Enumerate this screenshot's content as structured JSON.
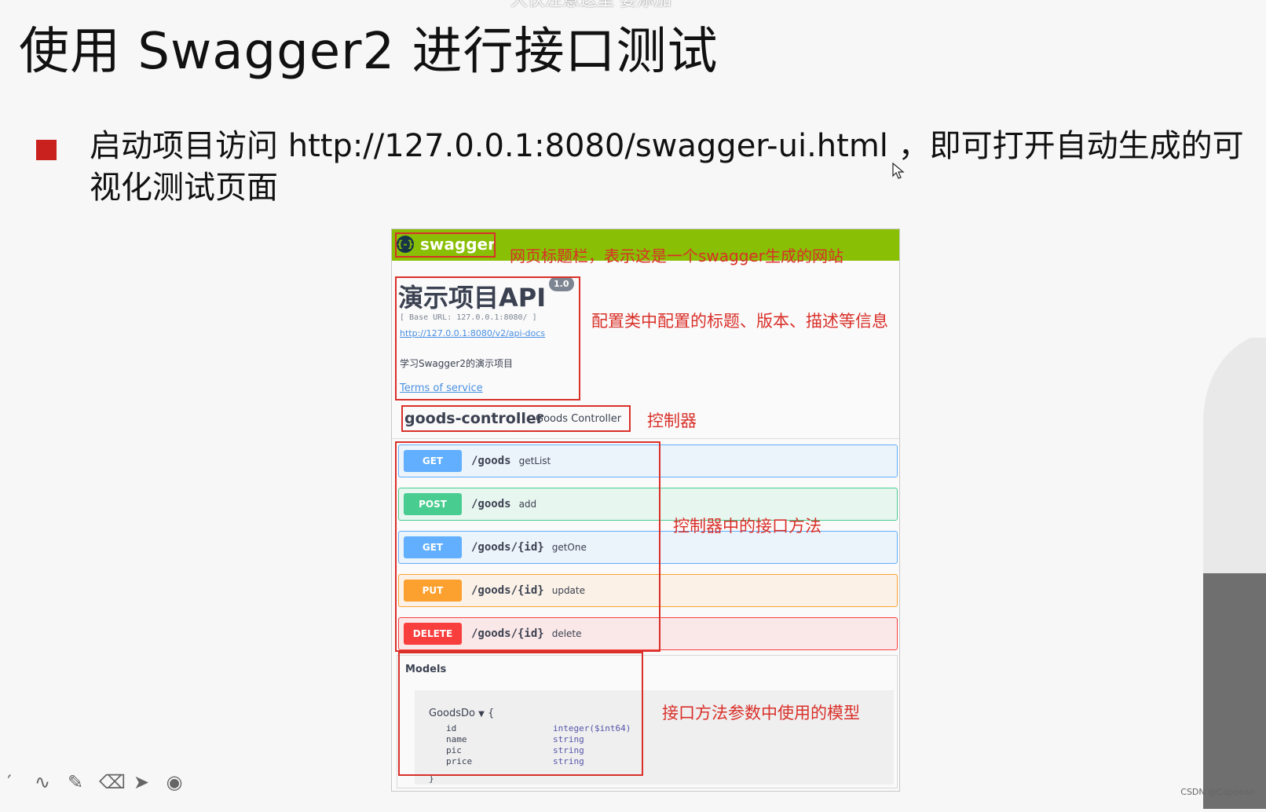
{
  "slide": {
    "title": "使用 Swagger2 进行接口测试",
    "top_subtitle": "大伙注意这里 要添加",
    "bullet_text": "启动项目访问 http://127.0.0.1:8080/swagger-ui.html ，即可打开自动生成的可视化测试页面"
  },
  "swagger": {
    "brand": "swagger",
    "logo_icon": "{-}",
    "api_title": "演示项目API",
    "version": "1.0",
    "base_url": "[ Base URL: 127.0.0.1:8080/ ]",
    "docs_link": "http://127.0.0.1:8080/v2/api-docs",
    "description": "学习Swagger2的演示项目",
    "terms_link": "Terms of service",
    "controller_name": "goods-controller",
    "controller_desc": "Goods Controller",
    "operations": [
      {
        "method": "GET",
        "path": "/goods",
        "summary": "getList",
        "color": "#61affe",
        "bg": "#ebf3fb",
        "border": "#61affe"
      },
      {
        "method": "POST",
        "path": "/goods",
        "summary": "add",
        "color": "#49cc90",
        "bg": "#e8f6f0",
        "border": "#49cc90"
      },
      {
        "method": "GET",
        "path": "/goods/{id}",
        "summary": "getOne",
        "color": "#61affe",
        "bg": "#ebf3fb",
        "border": "#61affe"
      },
      {
        "method": "PUT",
        "path": "/goods/{id}",
        "summary": "update",
        "color": "#fca130",
        "bg": "#fbf1e6",
        "border": "#fca130"
      },
      {
        "method": "DELETE",
        "path": "/goods/{id}",
        "summary": "delete",
        "color": "#f93e3e",
        "bg": "#fae7e7",
        "border": "#f93e3e"
      }
    ],
    "models_title": "Models",
    "model_name": "GoodsDo",
    "model_open": "{",
    "model_close": "}",
    "model_props": [
      {
        "name": "id",
        "type": "integer($int64)"
      },
      {
        "name": "name",
        "type": "string"
      },
      {
        "name": "pic",
        "type": "string"
      },
      {
        "name": "price",
        "type": "string"
      }
    ]
  },
  "annotations": {
    "header": "网页标题栏，表示这是一个swagger生成的网站",
    "config": "配置类中配置的标题、版本、描述等信息",
    "controller": "控制器",
    "methods": "控制器中的接口方法",
    "models": "接口方法参数中使用的模型"
  },
  "toolbar_icons": [
    "pen-icon",
    "curve-icon",
    "highlighter-icon",
    "eraser-icon",
    "pointer-icon",
    "record-icon"
  ],
  "watermark": "CSDN @Cappean",
  "colors": {
    "bullet": "#c9211e",
    "annotation": "#d9302a",
    "swagger_green": "#89bf04"
  }
}
